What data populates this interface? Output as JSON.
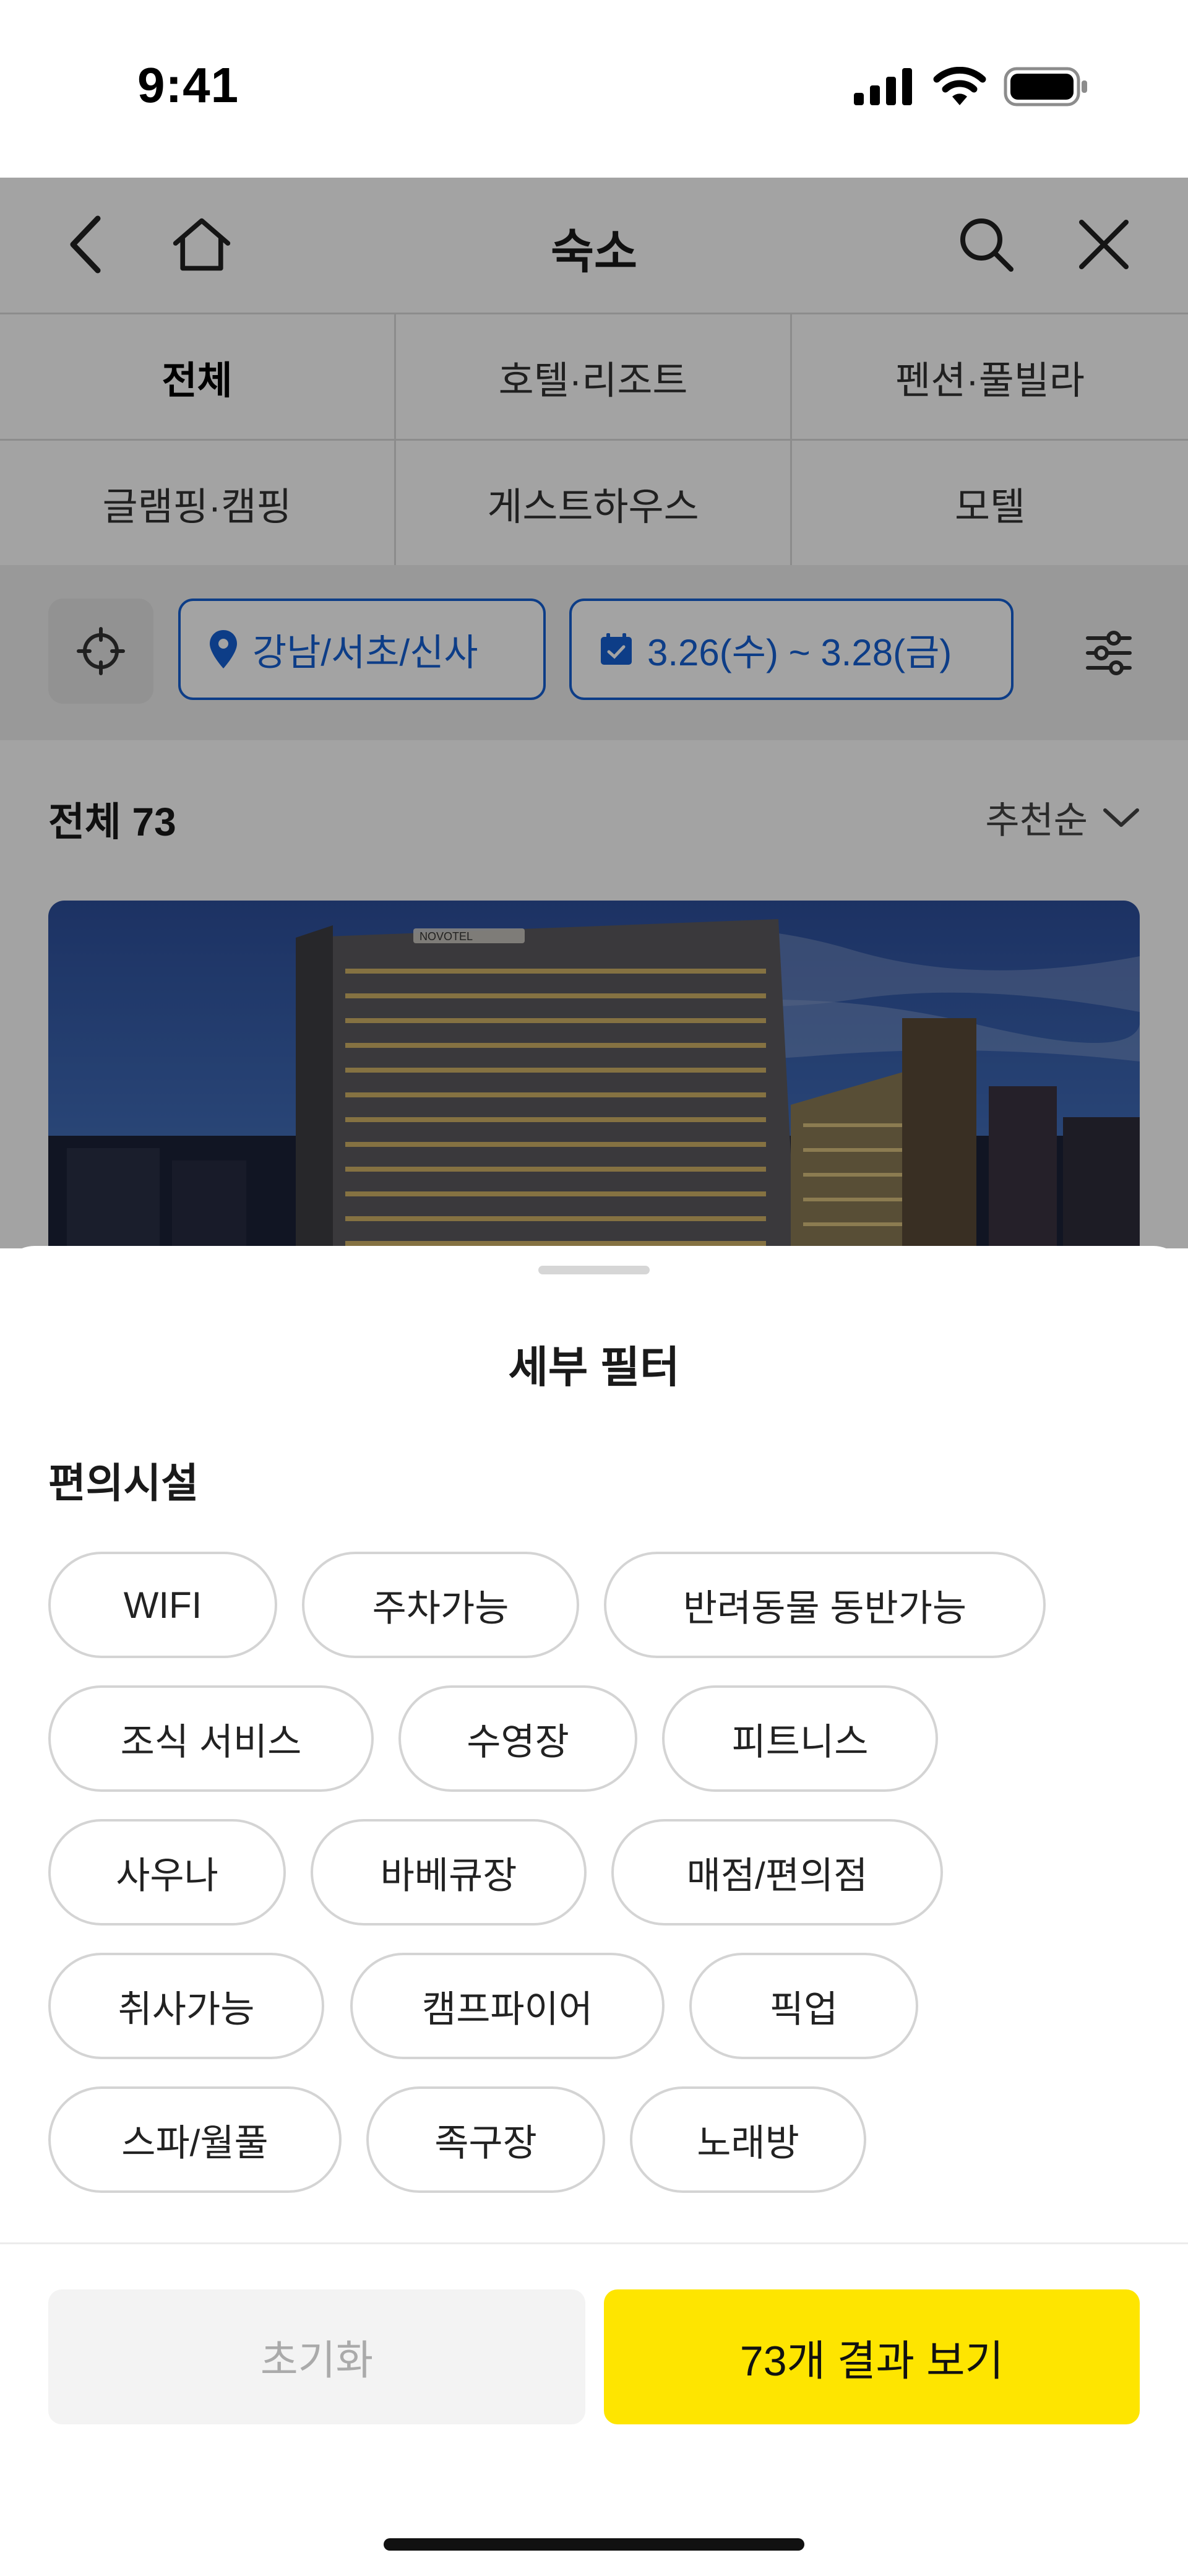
{
  "status_bar": {
    "time": "9:41",
    "icons": [
      "cellular-icon",
      "wifi-icon",
      "battery-icon"
    ]
  },
  "header": {
    "title": "숙소",
    "icons": [
      "back-icon",
      "home-icon",
      "search-icon",
      "close-icon"
    ]
  },
  "categories": [
    {
      "label": "전체",
      "active": true
    },
    {
      "label": "호텔·리조트",
      "active": false
    },
    {
      "label": "펜션·풀빌라",
      "active": false
    },
    {
      "label": "글램핑·캠핑",
      "active": false
    },
    {
      "label": "게스트하우스",
      "active": false
    },
    {
      "label": "모텔",
      "active": false
    }
  ],
  "filters": {
    "location": "강남/서초/신사",
    "dates": "3.26(수) ~ 3.28(금)",
    "accent_color": "#1560d4"
  },
  "results": {
    "count_label": "전체 73",
    "sort_label": "추천순"
  },
  "hotel_card": {
    "sign_text": "NOVOTEL"
  },
  "sheet": {
    "title": "세부 필터",
    "section_title": "편의시설",
    "amenities": [
      "WIFI",
      "주차가능",
      "반려동물 동반가능",
      "조식 서비스",
      "수영장",
      "피트니스",
      "사우나",
      "바베큐장",
      "매점/편의점",
      "취사가능",
      "캠프파이어",
      "픽업",
      "스파/월풀",
      "족구장",
      "노래방"
    ],
    "reset_label": "초기화",
    "show_label": "73개 결과 보기",
    "show_color": "#fee500"
  }
}
